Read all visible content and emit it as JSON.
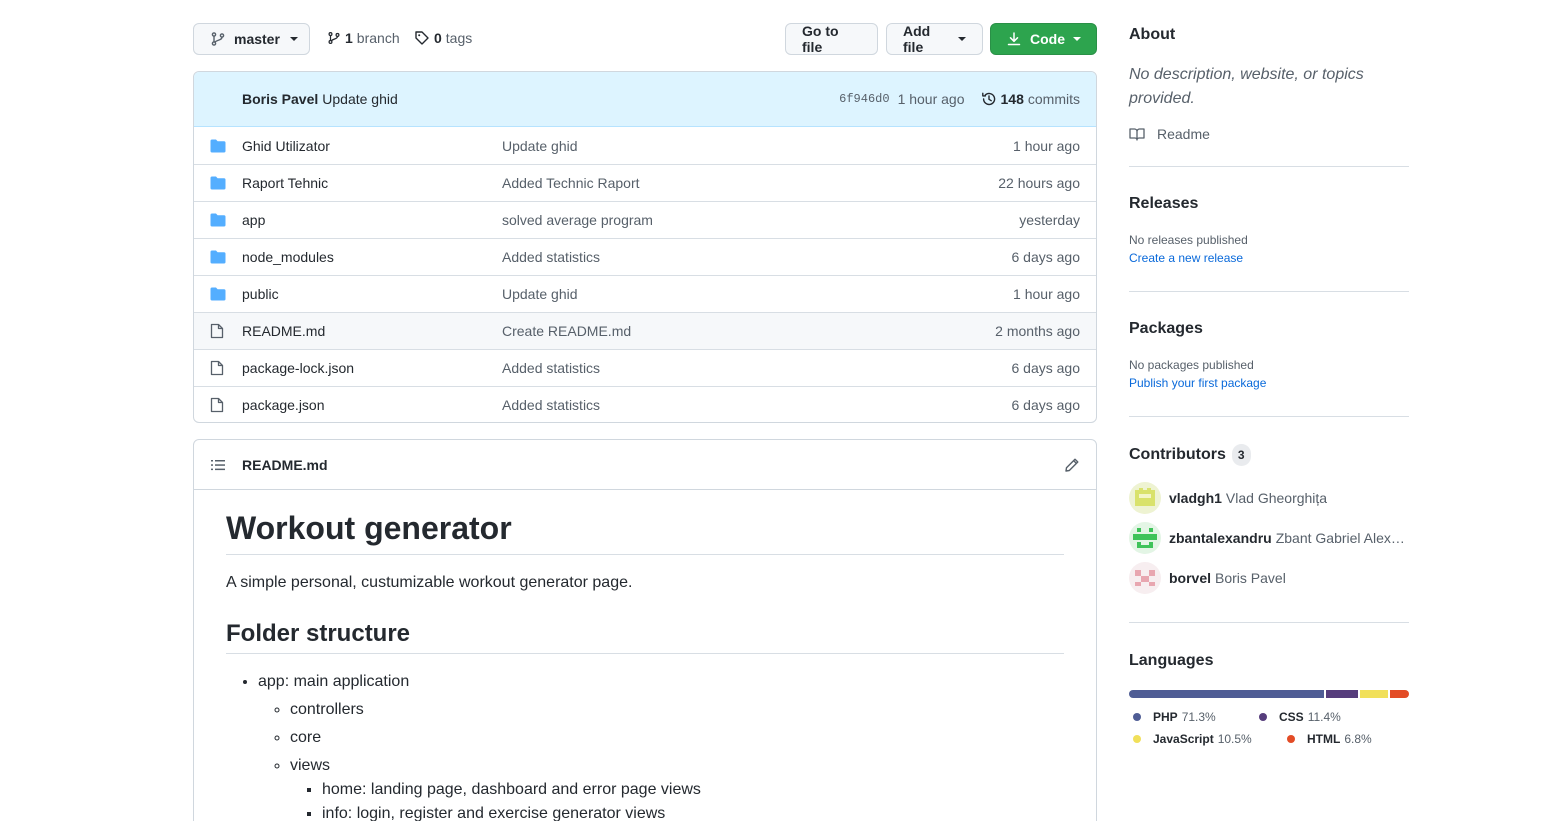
{
  "toolbar": {
    "branch": "master",
    "branch_count": "1",
    "branch_label": "branch",
    "tag_count": "0",
    "tag_label": "tags",
    "goto_label": "Go to file",
    "add_label": "Add file",
    "code_label": "Code"
  },
  "commit": {
    "author": "Boris Pavel",
    "message": "Update ghid",
    "sha": "6f946d0",
    "time": "1 hour ago",
    "count": "148",
    "count_label": "commits"
  },
  "files": [
    {
      "name": "Ghid Utilizator",
      "message": "Update ghid",
      "age": "1 hour ago",
      "type": "folder"
    },
    {
      "name": "Raport Tehnic",
      "message": "Added Technic Raport",
      "age": "22 hours ago",
      "type": "folder"
    },
    {
      "name": "app",
      "message": "solved average program",
      "age": "yesterday",
      "type": "folder"
    },
    {
      "name": "node_modules",
      "message": "Added statistics",
      "age": "6 days ago",
      "type": "folder"
    },
    {
      "name": "public",
      "message": "Update ghid",
      "age": "1 hour ago",
      "type": "folder"
    },
    {
      "name": "README.md",
      "message": "Create README.md",
      "age": "2 months ago",
      "type": "file"
    },
    {
      "name": "package-lock.json",
      "message": "Added statistics",
      "age": "6 days ago",
      "type": "file"
    },
    {
      "name": "package.json",
      "message": "Added statistics",
      "age": "6 days ago",
      "type": "file"
    }
  ],
  "readme": {
    "filename": "README.md",
    "title": "Workout generator",
    "intro": "A simple personal, custumizable workout generator page.",
    "h2": "Folder structure",
    "list": {
      "app": "app: main application",
      "controllers": "controllers",
      "core": "core",
      "views": "views",
      "home": "home: landing page, dashboard and error page views",
      "info": "info: login, register and exercise generator views"
    }
  },
  "about": {
    "heading": "About",
    "description": "No description, website, or topics provided.",
    "readme_link": "Readme"
  },
  "releases": {
    "heading": "Releases",
    "none": "No releases published",
    "link": "Create a new release"
  },
  "packages": {
    "heading": "Packages",
    "none": "No packages published",
    "link": "Publish your first package"
  },
  "contributors": {
    "heading": "Contributors",
    "count": "3",
    "people": [
      {
        "login": "vladgh1",
        "name": "Vlad Gheorghița"
      },
      {
        "login": "zbantalexandru",
        "name": "Zbant Gabriel Alexandru"
      },
      {
        "login": "borvel",
        "name": "Boris Pavel"
      }
    ]
  },
  "languages": {
    "heading": "Languages",
    "items": [
      {
        "name": "PHP",
        "percent": "71.3%",
        "value": 71.3,
        "color": "#4F5D95"
      },
      {
        "name": "CSS",
        "percent": "11.4%",
        "value": 11.4,
        "color": "#563d7c"
      },
      {
        "name": "JavaScript",
        "percent": "10.5%",
        "value": 10.5,
        "color": "#f1e05a"
      },
      {
        "name": "HTML",
        "percent": "6.8%",
        "value": 6.8,
        "color": "#e34c26"
      }
    ]
  },
  "colors": {
    "accent_green": "#2da44e",
    "link_blue": "#0969da",
    "folder_blue": "#54aeff",
    "commit_bar_bg": "#ddf4ff"
  }
}
